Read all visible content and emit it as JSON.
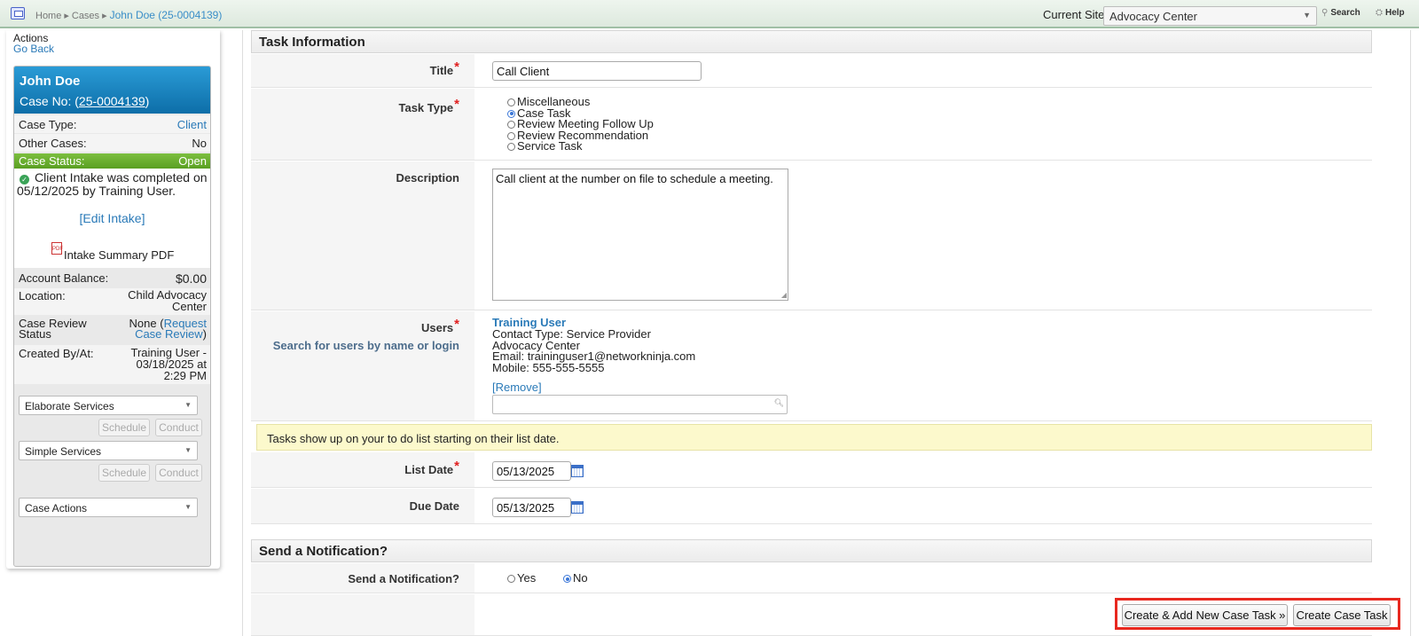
{
  "topbar": {
    "breadcrumb": [
      "Home",
      "Cases",
      "John Doe (25-0004139)"
    ],
    "current_site_label": "Current Site",
    "current_site_value": "Advocacy Center",
    "search_label": "Search",
    "help_label": "Help"
  },
  "sidebar": {
    "actions_label": "Actions",
    "go_back": "Go Back",
    "case_name": "John Doe",
    "case_no_label": "Case No: (",
    "case_no_value": "25-0004139",
    "case_no_close": ")",
    "case_type_label": "Case Type:",
    "case_type_value": "Client",
    "other_cases_label": "Other Cases:",
    "other_cases_value": "No",
    "case_status_label": "Case Status:",
    "case_status_value": "Open",
    "intake_text": "Client Intake was completed on 05/12/2025 by Training User.",
    "edit_intake": "[Edit Intake]",
    "intake_pdf": "Intake Summary PDF",
    "account_balance_label": "Account Balance:",
    "account_balance_value": "$0.00",
    "location_label": "Location:",
    "location_value_1": "Child Advocacy",
    "location_value_2": "Center",
    "review_label_1": "Case Review",
    "review_label_2": "Status",
    "review_value_none": "None (",
    "review_link_1": "Request",
    "review_link_2": "Case Review",
    "review_close": ")",
    "created_label": "Created By/At:",
    "created_value_1": "Training User -",
    "created_value_2": "03/18/2025 at",
    "created_value_3": "2:29 PM",
    "elaborate_services": "Elaborate Services",
    "simple_services": "Simple Services",
    "case_actions": "Case Actions",
    "schedule_label": "Schedule",
    "conduct_label": "Conduct"
  },
  "form": {
    "task_info_header": "Task Information",
    "title_label": "Title",
    "title_value": "Call Client",
    "task_type_label": "Task Type",
    "task_type_options": [
      "Miscellaneous",
      "Case Task",
      "Review Meeting Follow Up",
      "Review Recommendation",
      "Service Task"
    ],
    "task_type_selected": "Case Task",
    "description_label": "Description",
    "description_value": "Call client at the number on file to schedule a meeting.",
    "users_label": "Users",
    "users_sublabel": "Search for users by name or login",
    "user": {
      "name": "Training User",
      "contact_type": "Contact Type: Service Provider",
      "org": "Advocacy Center",
      "email": "Email: traininguser1@networkninja.com",
      "mobile": "Mobile: 555-555-5555"
    },
    "remove_label": "[Remove]",
    "notice": "Tasks show up on your to do list starting on their list date.",
    "list_date_label": "List Date",
    "list_date_value": "05/13/2025",
    "due_date_label": "Due Date",
    "due_date_value": "05/13/2025",
    "notification_header": "Send a Notification?",
    "notification_label": "Send a Notification?",
    "notification_yes": "Yes",
    "notification_no": "No",
    "notification_selected": "No",
    "create_add_button": "Create & Add New Case Task »",
    "create_button": "Create Case Task"
  },
  "colors": {
    "header_blue": "#0d6ea8",
    "status_green": "#5a9f22",
    "link_blue": "#2a7ab8",
    "required_red": "#e02020",
    "highlight_red": "#e8281f",
    "notice_yellow": "#fcf9cc"
  },
  "icons": [
    "home-icon",
    "search-icon",
    "help-icon",
    "check-icon",
    "pdf-icon",
    "calendar-icon",
    "chevron-down-icon",
    "magnifier-icon"
  ]
}
